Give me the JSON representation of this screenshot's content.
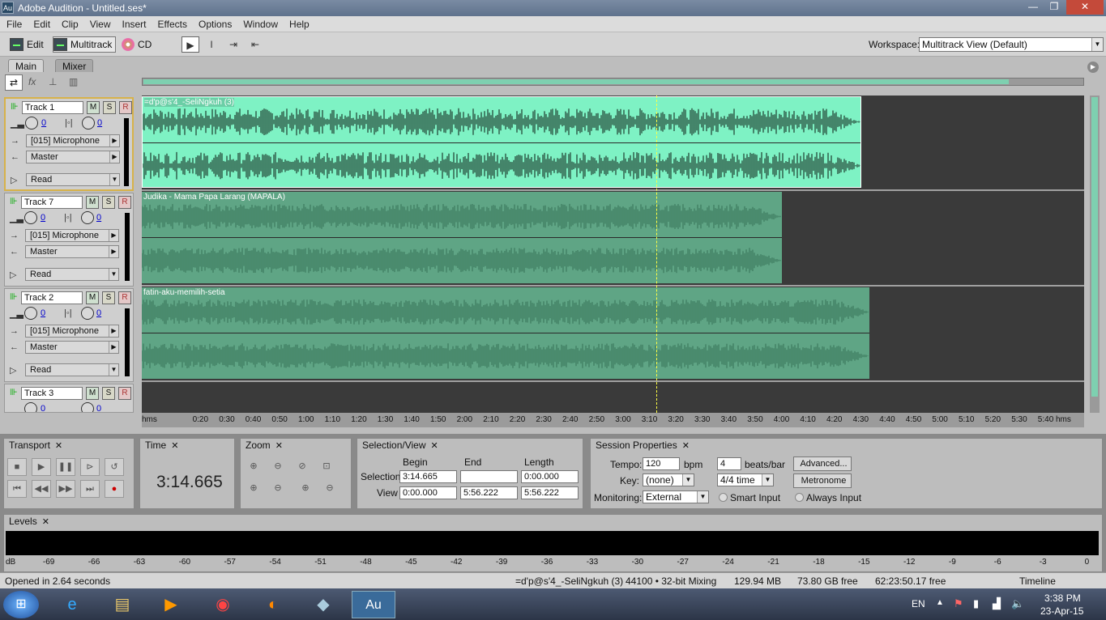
{
  "titlebar": {
    "app_icon": "Au",
    "title": "Adobe Audition - Untitled.ses*",
    "minimize": "—",
    "maximize": "❐",
    "close": "✕"
  },
  "menu": [
    "File",
    "Edit",
    "Clip",
    "View",
    "Insert",
    "Effects",
    "Options",
    "Window",
    "Help"
  ],
  "toolbar": {
    "edit": "Edit",
    "multitrack": "Multitrack",
    "cd": "CD",
    "workspace_label": "Workspace:",
    "workspace_value": "Multitrack View (Default)"
  },
  "tabs": {
    "main": "Main",
    "mixer": "Mixer"
  },
  "tracks": [
    {
      "name": "Track 1",
      "vol": "0",
      "pan": "0",
      "input": "[015] Microphone",
      "output": "Master",
      "automation": "Read"
    },
    {
      "name": "Track 7",
      "vol": "0",
      "pan": "0",
      "input": "[015] Microphone",
      "output": "Master",
      "automation": "Read"
    },
    {
      "name": "Track 2",
      "vol": "0",
      "pan": "0",
      "input": "[015] Microphone",
      "output": "Master",
      "automation": "Read"
    },
    {
      "name": "Track 3",
      "vol": "0",
      "pan": "0"
    }
  ],
  "msr": {
    "m": "M",
    "s": "S",
    "r": "R"
  },
  "clips": [
    {
      "name": "=d'p@s'4_-SeliNgkuh (3)",
      "color": "#7ef2c4",
      "wave": "#1f3d2f"
    },
    {
      "name": "Judika - Mama Papa Larang (MAPALA)",
      "color": "#5fa585",
      "wave": "#3d7a5e"
    },
    {
      "name": "fatin-aku-memilih-setia",
      "color": "#5fa585",
      "wave": "#3d7a5e"
    }
  ],
  "ruler": [
    "hms",
    "0:20",
    "0:30",
    "0:40",
    "0:50",
    "1:00",
    "1:10",
    "1:20",
    "1:30",
    "1:40",
    "1:50",
    "2:00",
    "2:10",
    "2:20",
    "2:30",
    "2:40",
    "2:50",
    "3:00",
    "3:10",
    "3:20",
    "3:30",
    "3:40",
    "3:50",
    "4:00",
    "4:10",
    "4:20",
    "4:30",
    "4:40",
    "4:50",
    "5:00",
    "5:10",
    "5:20",
    "5:30",
    "5:40",
    "hms"
  ],
  "transport": {
    "title": "Transport"
  },
  "time": {
    "title": "Time",
    "value": "3:14.665"
  },
  "zoom": {
    "title": "Zoom"
  },
  "selection": {
    "title": "Selection/View",
    "begin": "Begin",
    "end": "End",
    "length": "Length",
    "sel_label": "Selection",
    "view_label": "View",
    "sel_begin": "3:14.665",
    "sel_end": "",
    "sel_length": "0:00.000",
    "view_begin": "0:00.000",
    "view_end": "5:56.222",
    "view_length": "5:56.222"
  },
  "session": {
    "title": "Session Properties",
    "tempo_label": "Tempo:",
    "tempo": "120",
    "bpm": "bpm",
    "beats": "4",
    "beats_label": "beats/bar",
    "advanced": "Advanced...",
    "key_label": "Key:",
    "key": "(none)",
    "time_sig": "4/4 time",
    "metronome": "Metronome",
    "monitoring_label": "Monitoring:",
    "monitoring": "External",
    "smart_input": "Smart Input",
    "always_input": "Always Input"
  },
  "levels": {
    "title": "Levels",
    "ticks": [
      "dB",
      "-69",
      "-66",
      "-63",
      "-60",
      "-57",
      "-54",
      "-51",
      "-48",
      "-45",
      "-42",
      "-39",
      "-36",
      "-33",
      "-30",
      "-27",
      "-24",
      "-21",
      "-18",
      "-15",
      "-12",
      "-9",
      "-6",
      "-3",
      "0"
    ]
  },
  "status": {
    "opened": "Opened in 2.64 seconds",
    "file": "=d'p@s'4_-SeliNgkuh (3)",
    "format": "44100 • 32-bit Mixing",
    "mem": "129.94 MB",
    "disk": "73.80 GB free",
    "time_free": "62:23:50.17 free",
    "mode": "Timeline"
  },
  "taskbar": {
    "lang": "EN",
    "clock": "3:38 PM",
    "date": "23-Apr-15",
    "active_app": "Au"
  }
}
